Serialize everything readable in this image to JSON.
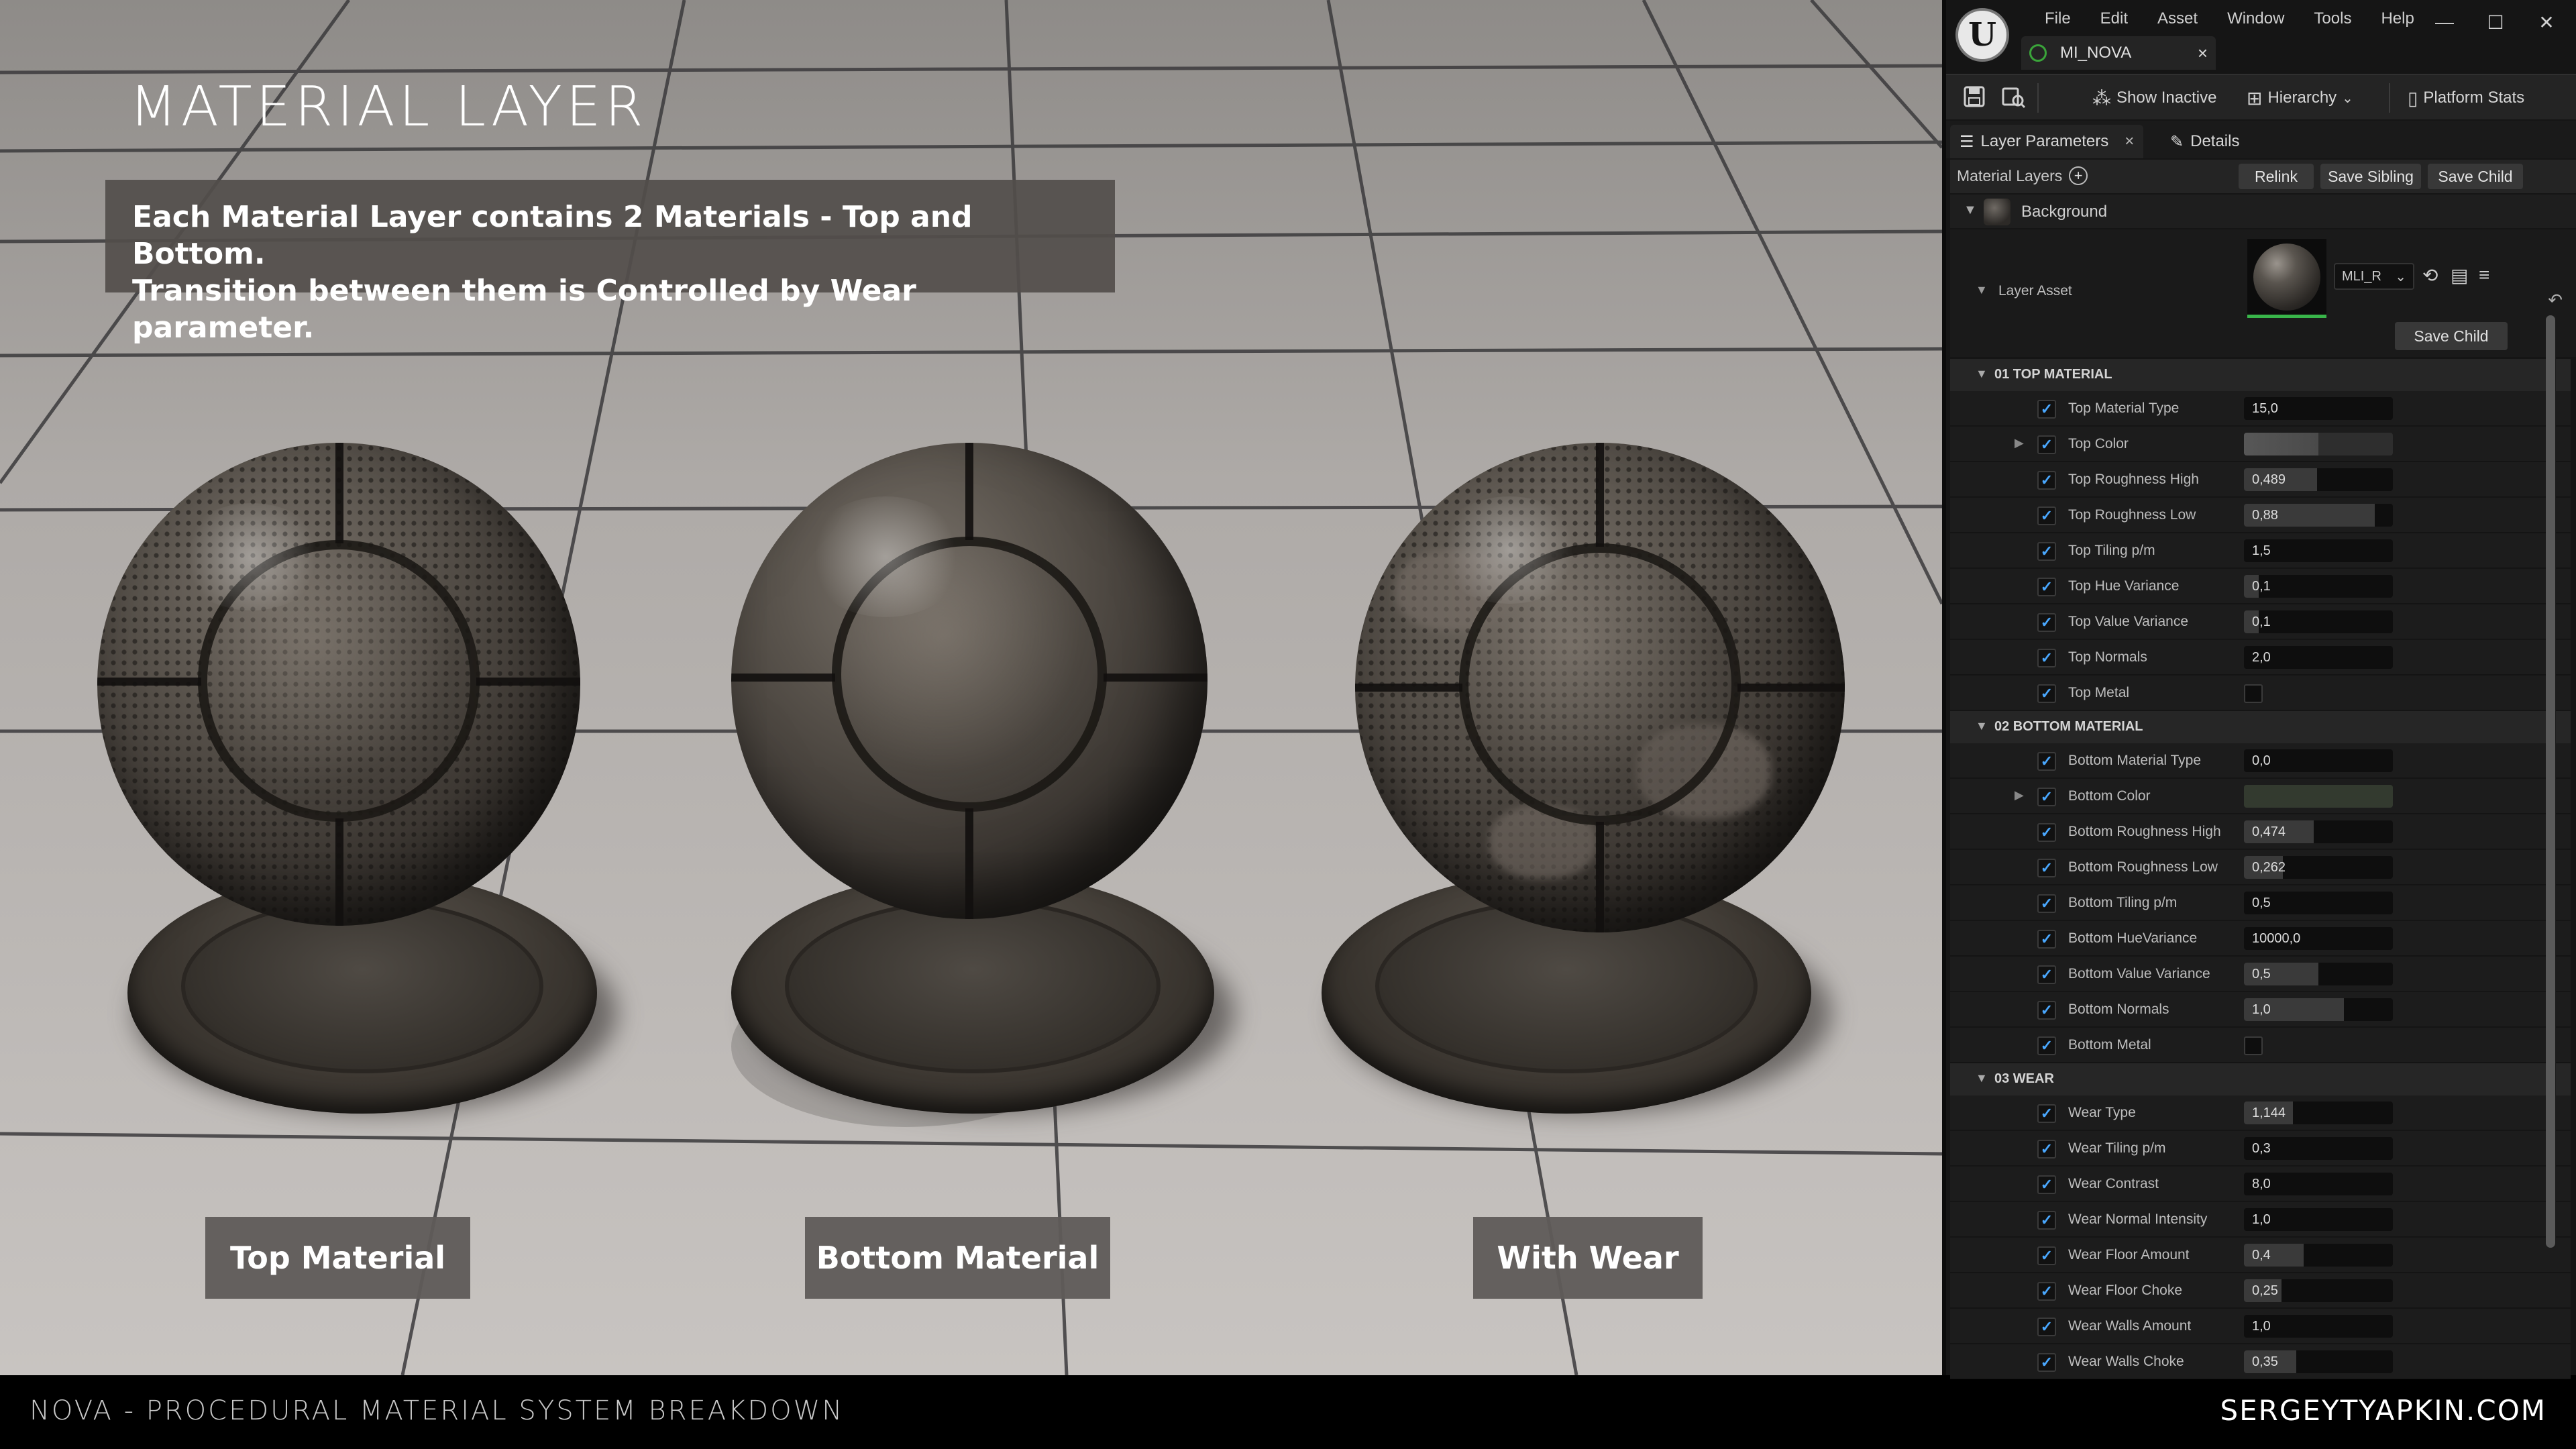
{
  "slide": {
    "title": "MATERIAL LAYER",
    "description_line1": "Each Material Layer contains 2 Materials - Top and Bottom.",
    "description_line2": "Transition between them is Controlled by Wear parameter.",
    "captions": [
      "Top Material",
      "Bottom Material",
      "With Wear"
    ]
  },
  "footer": {
    "left": "NOVA - PROCEDURAL MATERIAL SYSTEM BREAKDOWN",
    "right": "SERGEYTYAPKIN.COM"
  },
  "editor": {
    "menu": [
      "File",
      "Edit",
      "Asset",
      "Window",
      "Tools",
      "Help"
    ],
    "window_controls": [
      "—",
      "☐",
      "✕"
    ],
    "asset_tab": {
      "name": "MI_NOVA",
      "close": "×"
    },
    "toolbar": {
      "show_inactive": "Show Inactive",
      "hierarchy": "Hierarchy",
      "platform_stats": "Platform Stats"
    },
    "panel_tabs": {
      "layer_parameters": "Layer Parameters",
      "layer_parameters_close": "×",
      "details": "Details"
    },
    "layers_header": {
      "label": "Material Layers",
      "relink": "Relink",
      "save_sibling": "Save Sibling",
      "save_child": "Save Child"
    },
    "background_row": {
      "label": "Background"
    },
    "layer_asset": {
      "label": "Layer Asset",
      "dropdown": "MLI_R",
      "save_child": "Save Child"
    },
    "sections": [
      {
        "title": "01 TOP MATERIAL",
        "params": [
          {
            "name": "Top Material Type",
            "type": "number",
            "value": "15,0",
            "fill": 0.0
          },
          {
            "name": "Top Color",
            "type": "color",
            "expandable": true,
            "color": "#4a4a4a"
          },
          {
            "name": "Top Roughness High",
            "type": "number",
            "value": "0,489",
            "fill": 0.49
          },
          {
            "name": "Top Roughness Low",
            "type": "number",
            "value": "0,88",
            "fill": 0.88
          },
          {
            "name": "Top Tiling p/m",
            "type": "number",
            "value": "1,5",
            "fill": 0.0
          },
          {
            "name": "Top Hue Variance",
            "type": "number",
            "value": "0,1",
            "fill": 0.1
          },
          {
            "name": "Top Value Variance",
            "type": "number",
            "value": "0,1",
            "fill": 0.1
          },
          {
            "name": "Top Normals",
            "type": "number",
            "value": "2,0",
            "fill": 0.0
          },
          {
            "name": "Top Metal",
            "type": "bool"
          }
        ]
      },
      {
        "title": "02 BOTTOM MATERIAL",
        "params": [
          {
            "name": "Bottom Material Type",
            "type": "number",
            "value": "0,0",
            "fill": 0.0
          },
          {
            "name": "Bottom Color",
            "type": "color",
            "expandable": true,
            "color": "#333a2f"
          },
          {
            "name": "Bottom Roughness High",
            "type": "number",
            "value": "0,474",
            "fill": 0.47
          },
          {
            "name": "Bottom Roughness Low",
            "type": "number",
            "value": "0,262",
            "fill": 0.26
          },
          {
            "name": "Bottom Tiling p/m",
            "type": "number",
            "value": "0,5",
            "fill": 0.0
          },
          {
            "name": "Bottom HueVariance",
            "type": "number",
            "value": "10000,0",
            "fill": 0.0
          },
          {
            "name": "Bottom Value Variance",
            "type": "number",
            "value": "0,5",
            "fill": 0.5
          },
          {
            "name": "Bottom Normals",
            "type": "number",
            "value": "1,0",
            "fill": 0.67
          },
          {
            "name": "Bottom Metal",
            "type": "bool"
          }
        ]
      },
      {
        "title": "03 WEAR",
        "params": [
          {
            "name": "Wear Type",
            "type": "number",
            "value": "1,144",
            "fill": 0.33
          },
          {
            "name": "Wear Tiling p/m",
            "type": "number",
            "value": "0,3",
            "fill": 0.0
          },
          {
            "name": "Wear Contrast",
            "type": "number",
            "value": "8,0",
            "fill": 0.0
          },
          {
            "name": "Wear Normal Intensity",
            "type": "number",
            "value": "1,0",
            "fill": 0.0
          },
          {
            "name": "Wear Floor Amount",
            "type": "number",
            "value": "0,4",
            "fill": 0.4
          },
          {
            "name": "Wear Floor Choke",
            "type": "number",
            "value": "0,25",
            "fill": 0.25
          },
          {
            "name": "Wear Walls Amount",
            "type": "number",
            "value": "1,0",
            "fill": 0.0
          },
          {
            "name": "Wear Walls Choke",
            "type": "number",
            "value": "0,35",
            "fill": 0.35
          }
        ]
      }
    ]
  }
}
